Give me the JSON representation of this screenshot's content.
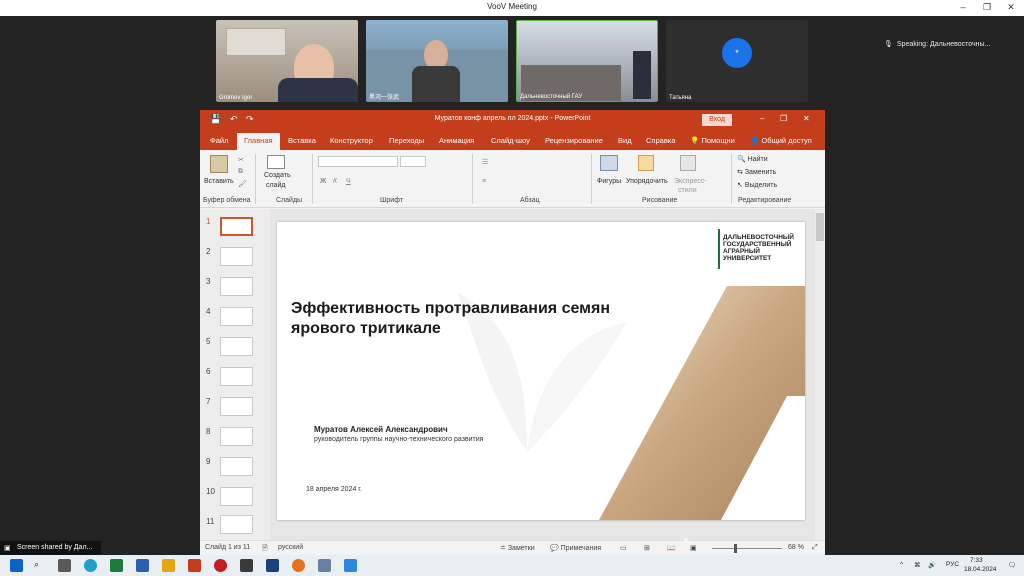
{
  "window": {
    "title": "VooV Meeting"
  },
  "participants": [
    {
      "name": "Gromov Igor"
    },
    {
      "name": "黑河一张武"
    },
    {
      "name": "Дальневосточный ГАУ"
    },
    {
      "name": "Татьяна"
    }
  ],
  "speaking": "Speaking: Дальневосточны...",
  "ppt": {
    "title": "Муратов конф апрель пл 2024.pptx  -  PowerPoint",
    "signin": "Вход",
    "tabs": [
      "Файл",
      "Главная",
      "Вставка",
      "Конструктор",
      "Переходы",
      "Анимация",
      "Слайд-шоу",
      "Рецензирование",
      "Вид",
      "Справка"
    ],
    "help": "Помощни",
    "share": "Общий доступ",
    "ribbon": {
      "paste": "Вставить",
      "new_slide_1": "Создать",
      "new_slide_2": "слайд",
      "shapes": "Фигуры",
      "arrange": "Упорядочить",
      "express_1": "Экспресс-",
      "express_2": "стили",
      "find": "Найти",
      "replace": "Заменить",
      "select": "Выделить",
      "groups": [
        "Буфер обмена",
        "Слайды",
        "Шрифт",
        "Абзац",
        "Рисование",
        "Редактирование"
      ]
    },
    "thumbnail_numbers": [
      "1",
      "2",
      "3",
      "4",
      "5",
      "6",
      "7",
      "8",
      "9",
      "10",
      "11"
    ],
    "slide": {
      "logo_line1": "ДАЛЬНЕВОСТОЧНЫЙ",
      "logo_line2": "ГОСУДАРСТВЕННЫЙ",
      "logo_line3": "АГРАРНЫЙ",
      "logo_line4": "УНИВЕРСИТЕТ",
      "title_line1": "Эффективность протравливания семян",
      "title_line2": "ярового тритикале",
      "author": "Муратов Алексей Александрович",
      "position": "руководитель группы научно-технического развития",
      "date": "18 апреля 2024 г."
    },
    "status": {
      "slide_count": "Слайд 1 из 11",
      "language": "русский",
      "notes": "Заметки",
      "comments": "Примечания",
      "zoom": "68 %"
    }
  },
  "share_banner": "Screen shared by Дал...",
  "taskbar": {
    "lang": "РУС",
    "time": "7:33",
    "date": "18.04.2024"
  },
  "colors": {
    "ppt_accent": "#c43e1c",
    "voov_blue": "#1a73e8"
  }
}
